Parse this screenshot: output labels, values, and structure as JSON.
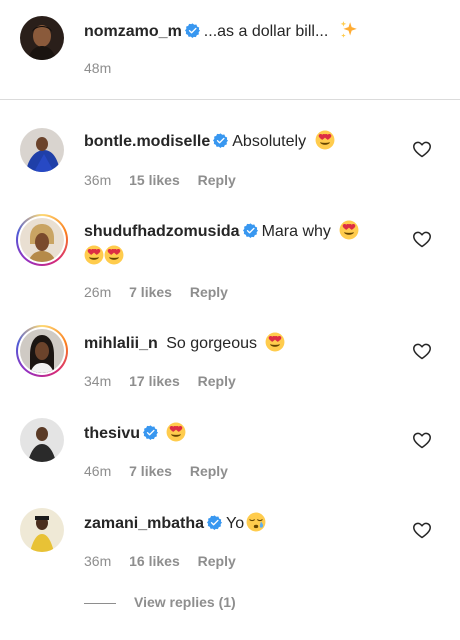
{
  "caption": {
    "username": "nomzamo_m",
    "text": "...as a dollar bill...",
    "time": "48m"
  },
  "comments": [
    {
      "username": "bontle.modiselle",
      "text": "Absolutely",
      "time": "36m",
      "likes": "15 likes",
      "reply": "Reply"
    },
    {
      "username": "shudufhadzomusida",
      "text": "Mara why",
      "time": "26m",
      "likes": "7 likes",
      "reply": "Reply"
    },
    {
      "username": "mihlalii_n",
      "text": "So gorgeous",
      "time": "34m",
      "likes": "17 likes",
      "reply": "Reply"
    },
    {
      "username": "thesivu",
      "text": "",
      "time": "46m",
      "likes": "7 likes",
      "reply": "Reply"
    },
    {
      "username": "zamani_mbatha",
      "text": "Yo",
      "time": "36m",
      "likes": "16 likes",
      "reply": "Reply"
    }
  ],
  "view_replies": "View replies (1)",
  "icons": {
    "verified": "verified-badge-icon",
    "heart": "heart-outline-icon",
    "heart_eyes": "heart-eyes-emoji",
    "sparkles": "sparkles-emoji",
    "sleepy": "sleepy-face-emoji"
  },
  "colors": {
    "verified_blue": "#3897f0",
    "meta_gray": "#8e8e8e",
    "emoji_yellow": "#ffcc4d",
    "heart_red": "#e0245e"
  }
}
